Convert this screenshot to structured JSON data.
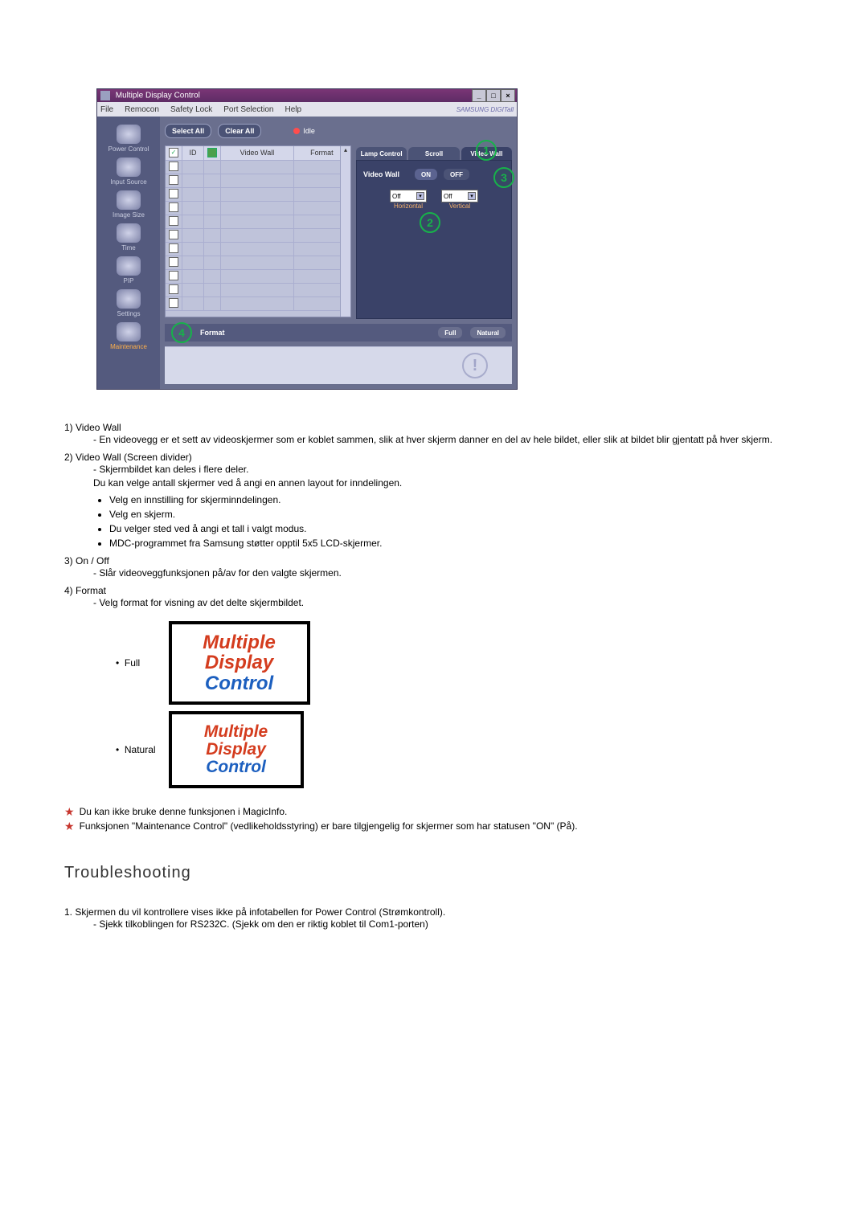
{
  "app": {
    "title": "Multiple Display Control",
    "menubar": [
      "File",
      "Remocon",
      "Safety Lock",
      "Port Selection",
      "Help"
    ],
    "brand": "SAMSUNG DIGITall",
    "sidebar": [
      {
        "label": "Power Control"
      },
      {
        "label": "Input Source"
      },
      {
        "label": "Image Size"
      },
      {
        "label": "Time"
      },
      {
        "label": "PIP"
      },
      {
        "label": "Settings"
      },
      {
        "label": "Maintenance",
        "active": true
      }
    ],
    "toolbar": {
      "select_all": "Select All",
      "clear_all": "Clear All",
      "idle": "Idle"
    },
    "grid": {
      "headers": {
        "id": "ID",
        "video_wall": "Video Wall",
        "format": "Format"
      },
      "row_count": 11
    },
    "right_panel": {
      "tabs": [
        "Lamp Control",
        "Scroll",
        "Video Wall"
      ],
      "active_tab": 2,
      "video_wall_label": "Video Wall",
      "on": "ON",
      "off": "OFF",
      "horizontal_label": "Horizontal",
      "vertical_label": "Vertical",
      "horizontal_value": "Off",
      "vertical_value": "Off"
    },
    "format_bar": {
      "label": "Format",
      "full": "Full",
      "natural": "Natural"
    },
    "markers": {
      "1": "1",
      "2": "2",
      "3": "3",
      "4": "4"
    }
  },
  "doc": {
    "items": [
      {
        "num": "1)",
        "title": "Video Wall",
        "sub": "- En videovegg er et sett av videoskjermer som er koblet sammen, slik at hver skjerm danner en del av hele bildet, eller slik at bildet blir gjentatt på hver skjerm."
      },
      {
        "num": "2)",
        "title": "Video Wall (Screen divider)",
        "sub": "- Skjermbildet kan deles i flere deler.\nDu kan velge antall skjermer ved å angi en annen layout for inndelingen.",
        "bullets": [
          "Velg en innstilling for skjerminndelingen.",
          "Velg en skjerm.",
          "Du velger sted ved å angi et tall i valgt modus.",
          "MDC-programmet fra Samsung støtter opptil 5x5 LCD-skjermer."
        ]
      },
      {
        "num": "3)",
        "title": "On / Off",
        "sub": "- Slår videoveggfunksjonen på/av for den valgte skjermen."
      },
      {
        "num": "4)",
        "title": "Format",
        "sub": "- Velg format for visning av det delte skjermbildet."
      }
    ],
    "format_rows": {
      "full": "Full",
      "natural": "Natural"
    },
    "mdc_text": {
      "line1": "Multiple",
      "line2": "Display",
      "line3": "Control"
    },
    "star_notes": [
      "Du kan ikke bruke denne funksjonen i MagicInfo.",
      "Funksjonen \"Maintenance Control\" (vedlikeholdsstyring) er bare tilgjengelig for skjermer som har statusen \"ON\" (På)."
    ],
    "troubleshooting_heading": "Troubleshooting",
    "ts_item_num": "1.",
    "ts_item_text": "Skjermen du vil kontrollere vises ikke på infotabellen for Power Control (Strømkontroll).",
    "ts_item_sub": "- Sjekk tilkoblingen for RS232C. (Sjekk om den er riktig koblet til Com1-porten)"
  }
}
